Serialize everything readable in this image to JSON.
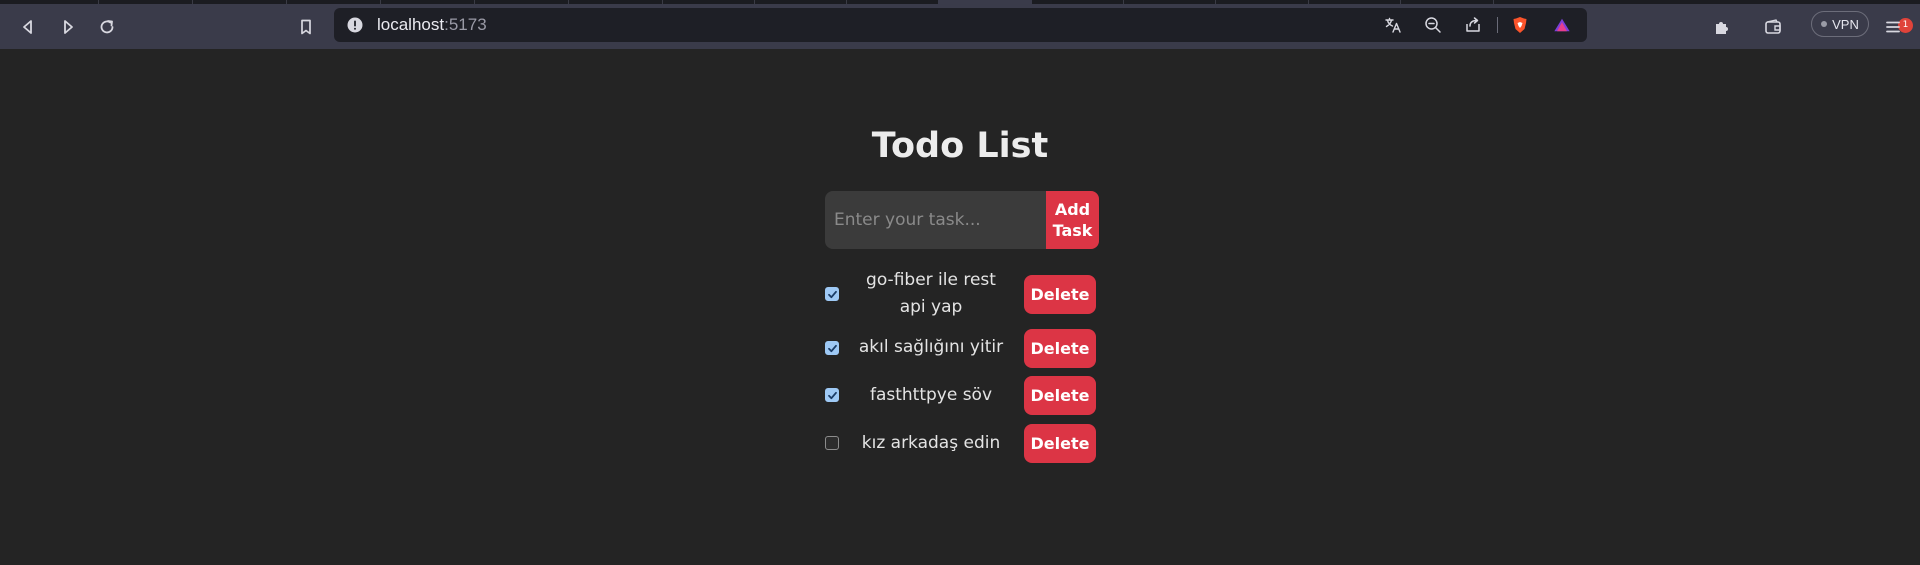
{
  "browser": {
    "url_host": "localhost",
    "url_port": ":5173",
    "shields_badge_count": "1",
    "vpn_label": "VPN",
    "accent_colors": {
      "toolbar": "#3a3b4a",
      "omnibox": "#1e1f26",
      "brave_orange": "#fb542b"
    },
    "icons": [
      "back-icon",
      "forward-icon",
      "reload-icon",
      "bookmark-icon",
      "site-info-icon",
      "translate-icon",
      "zoom-out-icon",
      "share-icon",
      "brave-shields-icon",
      "brave-rewards-icon",
      "extensions-icon",
      "wallet-icon",
      "menu-icon"
    ]
  },
  "app": {
    "title": "Todo List",
    "input": {
      "placeholder": "Enter your task...",
      "value": ""
    },
    "add_button_label": "Add Task",
    "delete_label": "Delete",
    "accent_color": "#dc3545",
    "background_color": "#242424",
    "todos": [
      {
        "text": "go-fiber ile rest api yap",
        "done": true
      },
      {
        "text": "akıl sağlığını yitir",
        "done": true
      },
      {
        "text": "fasthttpye söv",
        "done": true
      },
      {
        "text": "kız arkadaş edin",
        "done": false
      }
    ]
  }
}
